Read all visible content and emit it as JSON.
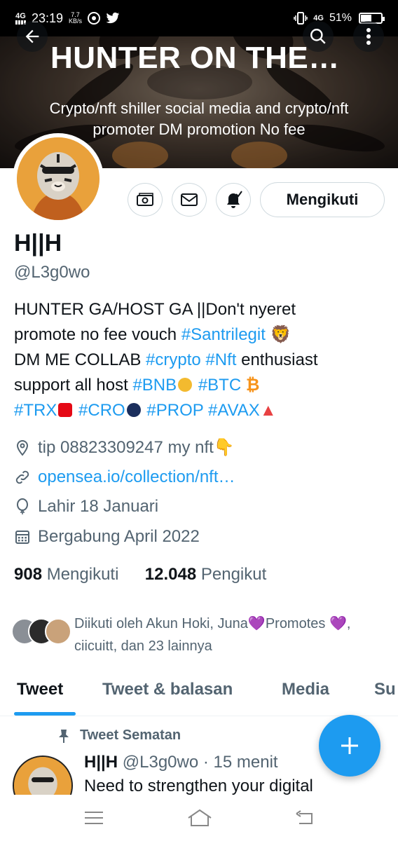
{
  "status_bar": {
    "time": "23:19",
    "network_left": "4G",
    "speed_value": "7.7",
    "speed_unit": "KB/s",
    "network_right": "4G",
    "battery": "51%"
  },
  "banner": {
    "title": "HUNTER ON THE…",
    "subtitle": "Crypto/nft shiller social media and crypto/nft promoter DM promotion No fee"
  },
  "profile": {
    "name": "H||H",
    "handle": "@L3g0wo",
    "follow_button": "Mengikuti",
    "bio": {
      "line1": "HUNTER GA/HOST GA ||Don't nyeret",
      "line2a": "promote no fee vouch  ",
      "tag_santri": "#Santrilegit",
      "lion": "🦁",
      "line3a": "DM ME COLLAB ",
      "tag_crypto": "#crypto",
      "tag_nft": "#Nft",
      "line3b": " enthusiast",
      "line4a": "support all host ",
      "tag_bnb": "#BNB",
      "tag_btc": "#BTC",
      "btc_symbol": "₿",
      "tag_trx": "#TRX",
      "tag_cro": "#CRO",
      "tag_prop": "#PROP",
      "tag_avax": "#AVAX",
      "avax_symbol": "▲"
    },
    "location": "tip 08823309247 my nft👇",
    "link": "opensea.io/collection/nft…",
    "birthday": "Lahir 18 Januari",
    "joined": "Bergabung April 2022",
    "following_count": "908",
    "following_label": "Mengikuti",
    "followers_count": "12.048",
    "followers_label": "Pengikut",
    "followed_by": "Diikuti oleh Akun Hoki, Juna💜Promotes 💜, ciicuitt, dan 23 lainnya"
  },
  "tabs": [
    "Tweet",
    "Tweet & balasan",
    "Media",
    "Su"
  ],
  "pinned_tweet": {
    "label": "Tweet Sematan",
    "name": "H||H",
    "handle_time": "@L3g0wo · 15 menit",
    "text": "Need to strengthen your digital"
  },
  "colors": {
    "accent": "#1d9bf0",
    "secondary_text": "#536471",
    "primary_text": "#0f1419"
  }
}
